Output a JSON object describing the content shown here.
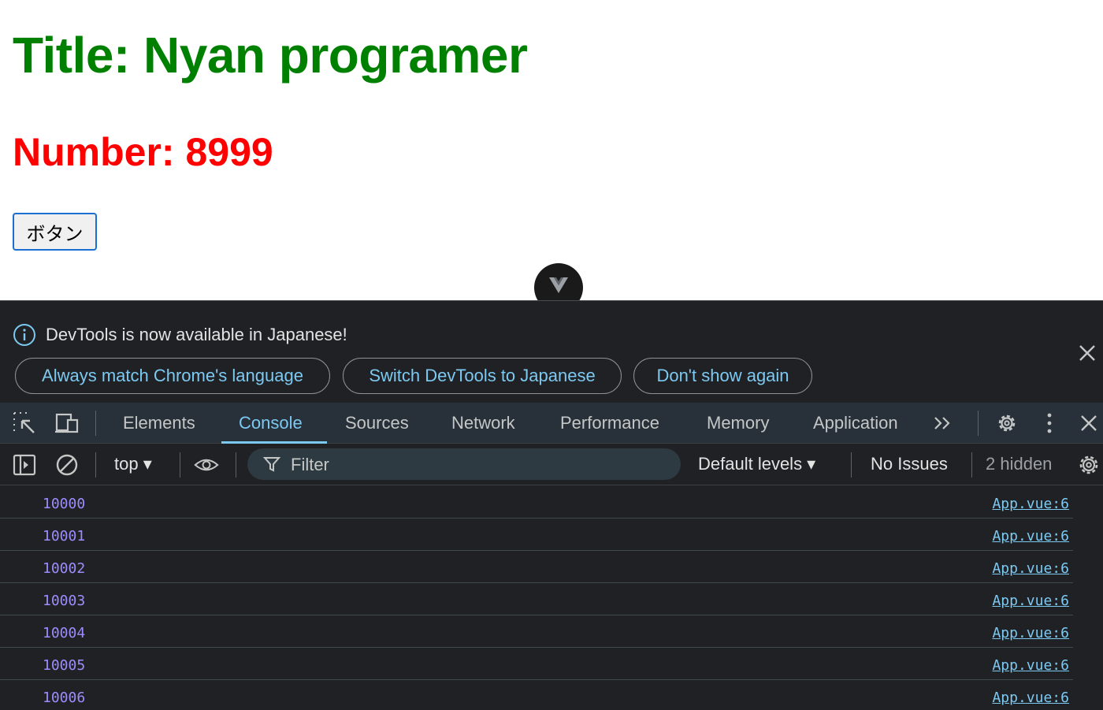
{
  "page": {
    "title": "Title: Nyan programer",
    "number": "Number: 8999",
    "button_label": "ボタン"
  },
  "devtools": {
    "infobar": {
      "message": "DevTools is now available in Japanese!",
      "buttons": [
        "Always match Chrome's language",
        "Switch DevTools to Japanese",
        "Don't show again"
      ]
    },
    "tabs": [
      "Elements",
      "Console",
      "Sources",
      "Network",
      "Performance",
      "Memory",
      "Application"
    ],
    "active_tab": "Console",
    "toolbar": {
      "context": "top ▾",
      "filter_placeholder": "Filter",
      "levels": "Default levels ▾",
      "issues": "No Issues",
      "hidden": "2 hidden"
    },
    "console_rows": [
      {
        "value": "10000",
        "source": "App.vue:6"
      },
      {
        "value": "10001",
        "source": "App.vue:6"
      },
      {
        "value": "10002",
        "source": "App.vue:6"
      },
      {
        "value": "10003",
        "source": "App.vue:6"
      },
      {
        "value": "10004",
        "source": "App.vue:6"
      },
      {
        "value": "10005",
        "source": "App.vue:6"
      },
      {
        "value": "10006",
        "source": "App.vue:6"
      }
    ]
  },
  "colors": {
    "title": "#008000",
    "number": "#ff0000",
    "accent": "#7cc9f2",
    "log_value": "#9e8cff"
  },
  "icons": [
    "info-icon",
    "close-icon",
    "inspect-element-icon",
    "device-toolbar-icon",
    "more-tabs-icon",
    "settings-icon",
    "kebab-menu-icon",
    "sidebar-toggle-icon",
    "clear-console-icon",
    "eye-icon",
    "filter-icon",
    "vue-devtools-icon"
  ]
}
